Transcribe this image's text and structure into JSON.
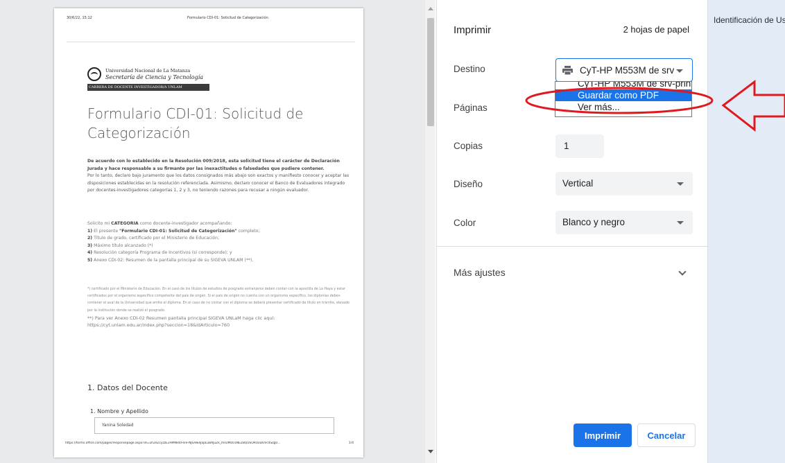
{
  "preview": {
    "header_date": "30/6/22, 15:12",
    "header_title": "Formulario CDI-01: Solicitud de Categorización",
    "logo_university": "Universidad Nacional de La Matanza",
    "logo_secretaria": "Secretaría de Ciencia y Tecnología",
    "logo_bar": "CARRERA DE DOCENTE INVESTIGADOR/A UNLAM",
    "form_title": "Formulario CDI-01: Solicitud de Categorización",
    "intro_bold": "De acuerdo con lo establecido en la Resolución 009/2018, esta solicitud tiene el carácter de Declaración Jurada y hace responsable a su firmante por las inexactitudes o falsedades que pudiere contener.",
    "intro_text": "Por lo tanto, declaro bajo juramento que los datos consignados más abajo son exactos y manifiesto conocer y aceptar las disposiciones establecidas en la resolución referenciada. Asimismo, declaro conocer el Banco de Evaluadores integrado por docentes-investigadores categorías 1, 2 y 3, no teniendo razones para recusar a ningún evaluador.",
    "request_prefix": "Solicito mi ",
    "request_bold": "CATEGORIA",
    "request_suffix": " como docente-investigador acompañando:",
    "items": [
      {
        "num": "1)",
        "pre": " El presente ",
        "bold": "\"Formulario CDI-01: Solicitud de Categorización\"",
        "post": " completo;"
      },
      {
        "num": "2)",
        "pre": " Título de grado, certificado por el Ministerio de Educación;",
        "bold": "",
        "post": ""
      },
      {
        "num": "3)",
        "pre": " Máximo título alcanzado (*)",
        "bold": "",
        "post": ""
      },
      {
        "num": "4)",
        "pre": " Resolución categoría Programa de Incentivos (si corresponde); y",
        "bold": "",
        "post": ""
      },
      {
        "num": "5)",
        "pre": " Anexo CDI-02: Resumen de la pantalla principal de su SIGEVA UNLAM (**).",
        "bold": "",
        "post": ""
      }
    ],
    "footnote_1": "*) certificado por el Ministerio de Educación. En el caso de los títulos de estudios de posgrado extranjeros deben contar con la apostilla de La Haya y estar certificados por el organismo específico competente del país de origen. Si el país de origen no cuenta con un organismo específico, los diplomas deben contener el aval de la Universidad que emite el diploma. En el caso de no contar con el diploma se deberá presentar certificado de título en trámite, elevado por la institución donde se realizó el posgrado.",
    "footnote_2": "**) Para ver Anexo CDI-02 Resumen pantalla principal SIGEVA UNLaM haga clic aquí: https://cyt.unlam.edu.ar/index.php?seccion=18&idArticulo=760",
    "section_title": "1. Datos del Docente",
    "question_label": "1. Nombre y Apellido",
    "answer_value": "Yanina Soledad",
    "footer_url": "https://forms.office.com/pages/responsepage.aspx?id=uh2eZcyzzE2HMNl4d-ere-NJG9w4jopLuBAJuZk_msUMzU1NEZBQUSORUxDUVc4Szg0...",
    "footer_page": "1/4"
  },
  "panel": {
    "title": "Imprimir",
    "sheets": "2 hojas de papel",
    "destino_label": "Destino",
    "destino_value": "CyT-HP M553M de srv",
    "paginas_label": "Páginas",
    "copias_label": "Copias",
    "copias_value": "1",
    "diseno_label": "Diseño",
    "diseno_value": "Vertical",
    "color_label": "Color",
    "color_value": "Blanco y negro",
    "more_label": "Más ajustes",
    "print_button": "Imprimir",
    "cancel_button": "Cancelar"
  },
  "dropdown": {
    "options": [
      "CyT-HP M553M de srv-print",
      "Guardar como PDF",
      "Ver más..."
    ],
    "selected_index": 1
  },
  "background_window": {
    "tab_text": "Identificación de Us"
  },
  "colors": {
    "accent": "#1a73e8",
    "annotation": "#e0191f"
  }
}
